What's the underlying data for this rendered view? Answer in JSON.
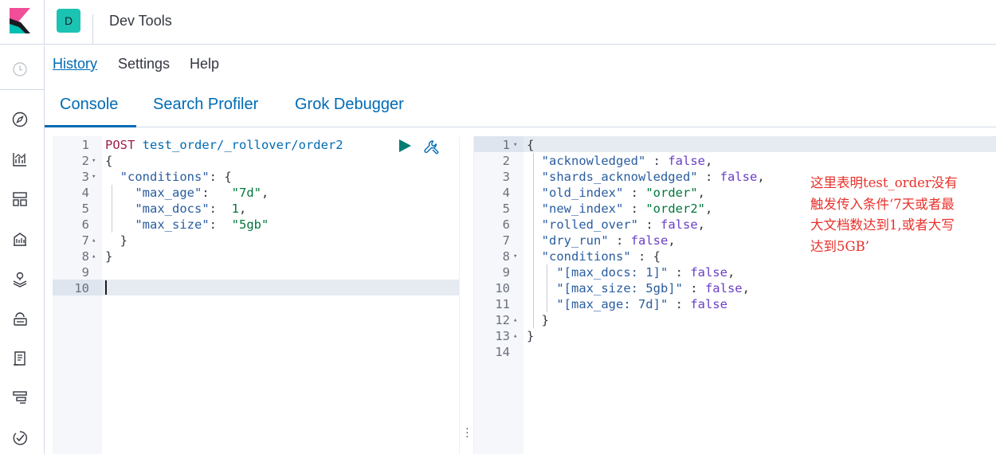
{
  "header": {
    "app_title": "Dev Tools",
    "avatar_letter": "D"
  },
  "top_links": {
    "history": "History",
    "settings": "Settings",
    "help": "Help"
  },
  "tabs": {
    "console": "Console",
    "search_profiler": "Search Profiler",
    "grok_debugger": "Grok Debugger"
  },
  "request": {
    "method": "POST",
    "path": "test_order/_rollover/order2",
    "conditions_key": "\"conditions\"",
    "max_age_key": "\"max_age\"",
    "max_age_val": "\"7d\"",
    "max_docs_key": "\"max_docs\"",
    "max_docs_val": "1",
    "max_size_key": "\"max_size\"",
    "max_size_val": "\"5gb\"",
    "line_numbers": [
      "1",
      "2",
      "3",
      "4",
      "5",
      "6",
      "7",
      "8",
      "9",
      "10"
    ]
  },
  "response": {
    "acknowledged_key": "\"acknowledged\"",
    "acknowledged_val": "false",
    "shards_key": "\"shards_acknowledged\"",
    "shards_val": "false",
    "old_index_key": "\"old_index\"",
    "old_index_val": "\"order\"",
    "new_index_key": "\"new_index\"",
    "new_index_val": "\"order2\"",
    "rolled_over_key": "\"rolled_over\"",
    "rolled_over_val": "false",
    "dry_run_key": "\"dry_run\"",
    "dry_run_val": "false",
    "conditions_key": "\"conditions\"",
    "cond_docs_key": "\"[max_docs: 1]\"",
    "cond_docs_val": "false",
    "cond_size_key": "\"[max_size: 5gb]\"",
    "cond_size_val": "false",
    "cond_age_key": "\"[max_age: 7d]\"",
    "cond_age_val": "false",
    "line_numbers": [
      "1",
      "2",
      "3",
      "4",
      "5",
      "6",
      "7",
      "8",
      "9",
      "10",
      "11",
      "12",
      "13",
      "14"
    ]
  },
  "annotation": {
    "line1": "这里表明test_order没有",
    "line2": "触发传入条件‘7天或者最",
    "line3": "大文档数达到1,或者大写",
    "line4": "达到5GB’"
  },
  "icons": [
    "kibana-logo-icon",
    "clock-icon",
    "compass-icon",
    "visualize-icon",
    "dashboard-icon",
    "canvas-icon",
    "maps-icon",
    "ml-icon",
    "logs-icon",
    "apm-icon",
    "uptime-icon",
    "play-icon",
    "wrench-icon"
  ],
  "colors": {
    "accent": "#006bb4",
    "avatar": "#1bc3b3",
    "annotation": "#e8312b"
  }
}
